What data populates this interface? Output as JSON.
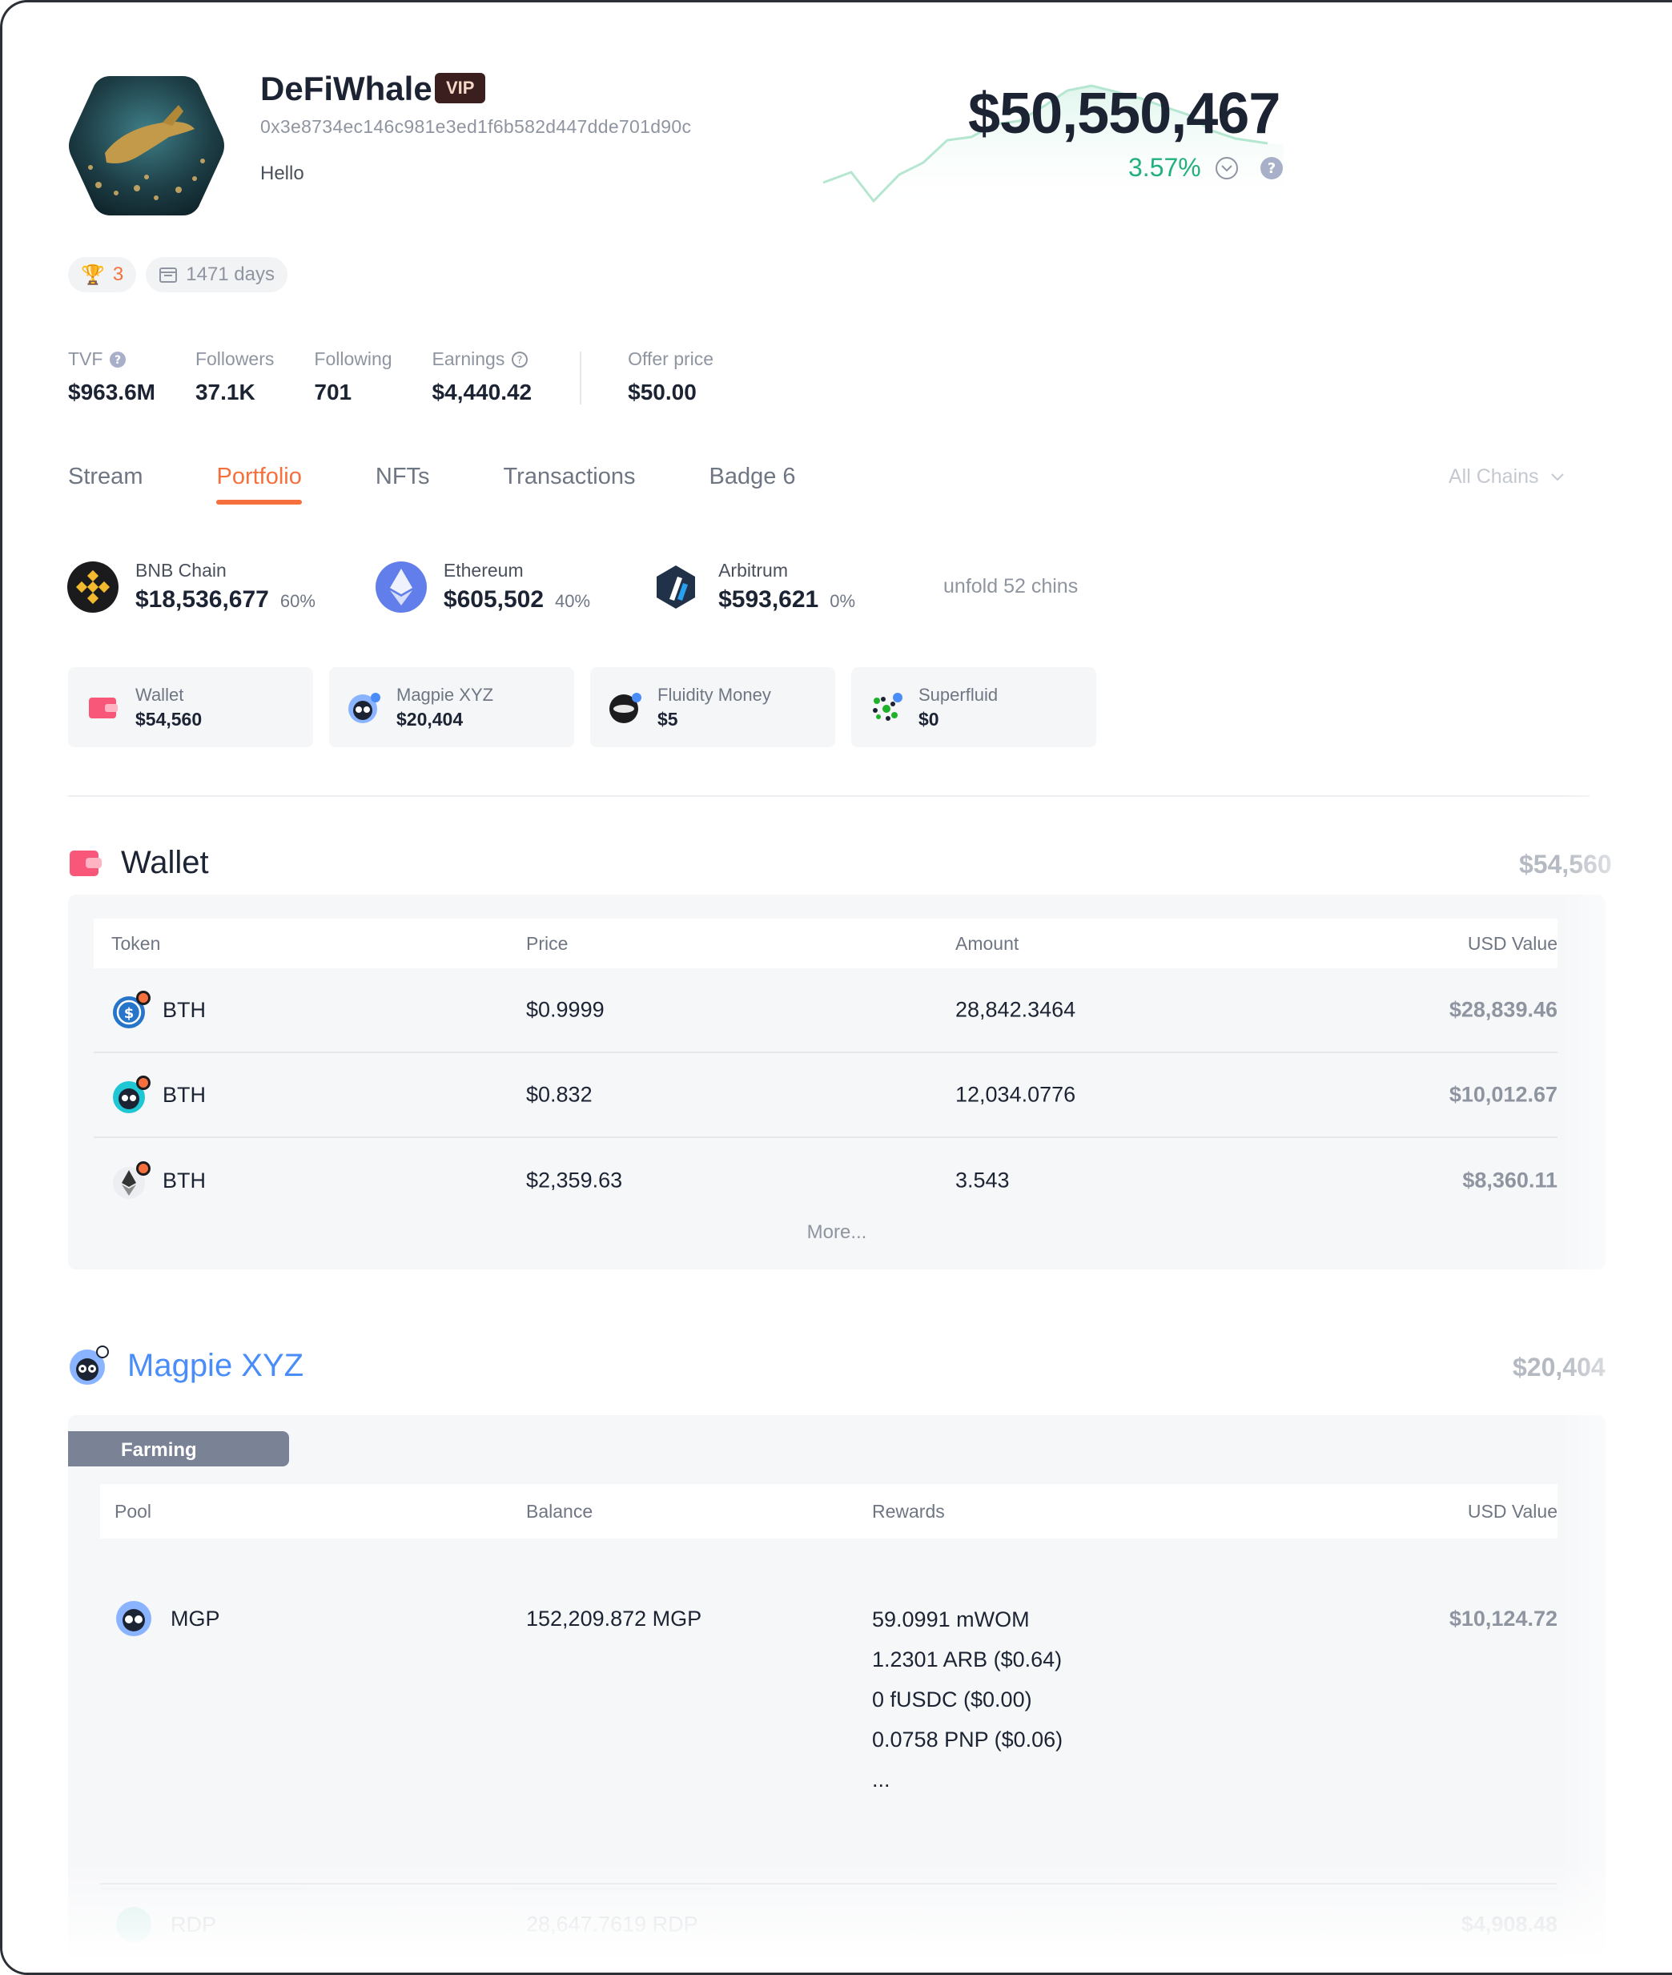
{
  "profile": {
    "username": "DeFiWhale",
    "badge": "VIP",
    "address": "0x3e8734ec146c981e3ed1f6b582d447dde701d90c",
    "bio": "Hello",
    "net_worth": "$50,550,467",
    "change": "3.57%",
    "achievements": "3",
    "days": "1471 days"
  },
  "stats": [
    {
      "label": "TVF",
      "value": "$963.6M"
    },
    {
      "label": "Followers",
      "value": "37.1K"
    },
    {
      "label": "Following",
      "value": "701"
    },
    {
      "label": "Earnings",
      "value": "$4,440.42"
    },
    {
      "label": "Offer price",
      "value": "$50.00"
    }
  ],
  "tabs": [
    "Stream",
    "Portfolio",
    "NFTs",
    "Transactions",
    "Badge 6"
  ],
  "active_tab": "Portfolio",
  "chain_filter": "All Chains",
  "chains": [
    {
      "name": "BNB Chain",
      "amount": "$18,536,677",
      "pct": "60%"
    },
    {
      "name": "Ethereum",
      "amount": "$605,502",
      "pct": "40%"
    },
    {
      "name": "Arbitrum",
      "amount": "$593,621",
      "pct": "0%"
    }
  ],
  "unfold_label": "unfold 52 chins",
  "protocols": [
    {
      "name": "Wallet",
      "value": "$54,560"
    },
    {
      "name": "Magpie XYZ",
      "value": "$20,404"
    },
    {
      "name": "Fluidity Money",
      "value": "$5"
    },
    {
      "name": "Superfluid",
      "value": "$0"
    }
  ],
  "wallet": {
    "title": "Wallet",
    "total": "$54,560",
    "columns": [
      "Token",
      "Price",
      "Amount",
      "USD Value"
    ],
    "rows": [
      {
        "token": "BTH",
        "price": "$0.9999",
        "amount": "28,842.3464",
        "usd": "$28,839.46"
      },
      {
        "token": "BTH",
        "price": "$0.832",
        "amount": "12,034.0776",
        "usd": "$10,012.67"
      },
      {
        "token": "BTH",
        "price": "$2,359.63",
        "amount": "3.543",
        "usd": "$8,360.11"
      }
    ],
    "more": "More..."
  },
  "magpie": {
    "title": "Magpie XYZ",
    "total": "$20,404",
    "tag": "Farming",
    "columns": [
      "Pool",
      "Balance",
      "Rewards",
      "USD Value"
    ],
    "rows": [
      {
        "pool": "MGP",
        "balance": "152,209.872 MGP",
        "rewards": [
          "59.0991 mWOM",
          "1.2301 ARB ($0.64)",
          "0 fUSDC ($0.00)",
          "0.0758 PNP ($0.06)",
          "..."
        ],
        "usd": "$10,124.72"
      },
      {
        "pool": "RDP",
        "balance": "28,647.7619 RDP",
        "rewards": [],
        "usd": "$4,908.48"
      }
    ]
  },
  "colors": {
    "accent": "#f5703c",
    "positive": "#22b07d",
    "link": "#4b8df8"
  }
}
